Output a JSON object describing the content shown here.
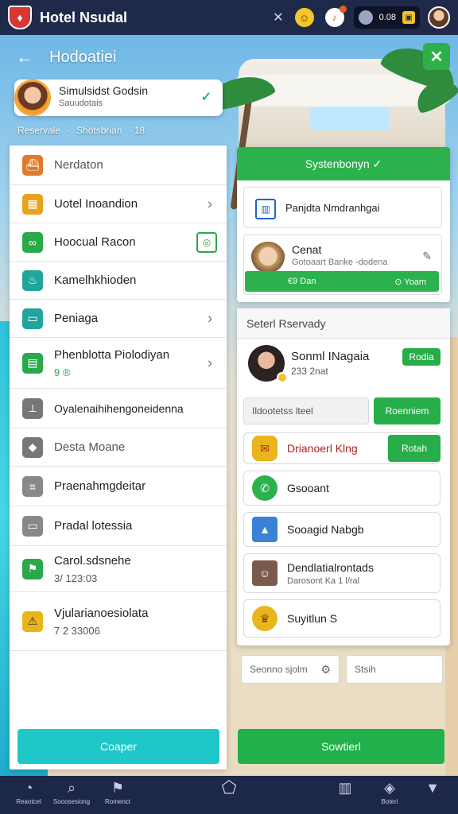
{
  "topbar": {
    "app_title": "Hotel Nsudal",
    "user_value": "0.08",
    "icons": [
      "shield-logo-icon",
      "close-icon",
      "emoji-icon",
      "bell-icon",
      "wallet-icon",
      "avatar"
    ]
  },
  "header": {
    "title": "Hodoatiei",
    "back_glyph": "←",
    "check_glyph": "✓"
  },
  "profile": {
    "name": "Simulsidst Godsin",
    "subtitle": "Sauudotais",
    "check_glyph": "✓"
  },
  "sublinks": [
    "Reservale",
    "·",
    "Shotsbrian",
    "· 18"
  ],
  "left_menu": [
    {
      "label": "Nerdaton",
      "icon": "ship-icon",
      "color": "#e07a2a",
      "chevron": false
    },
    {
      "label": "Uotel Inoandion",
      "icon": "hotel-icon",
      "color": "#e8a21d",
      "chevron": true
    },
    {
      "label": "Hoocual Racon",
      "icon": "link-icon",
      "color": "#2aa84a",
      "framed": true
    },
    {
      "label": "Kamelhkhioden",
      "icon": "kettle-icon",
      "color": "#1fa59a",
      "chevron": false
    },
    {
      "label": "Peniaga",
      "icon": "monitor-icon",
      "color": "#1fa59a",
      "chevron": true
    },
    {
      "label": "Phenblotta Piolodiyan",
      "sublabel": "9 ®",
      "icon": "briefcase-icon",
      "color": "#2aa84a",
      "chevron": true
    },
    {
      "label": "Oyalenaihihengoneidenna",
      "icon": "antenna-icon",
      "color": "#555555",
      "chevron": false
    },
    {
      "label": "Desta Moane",
      "icon": "diamond-icon",
      "color": "#555555",
      "chevron": false
    },
    {
      "label": "Praenahmgdeitar",
      "icon": "stack-icon",
      "color": "#777777",
      "chevron": false
    },
    {
      "label": "Pradal lotessia",
      "icon": "card-icon",
      "color": "#777777",
      "chevron": false
    },
    {
      "label": "Carol.sdsnehe",
      "sublabel": "3/ 123:03",
      "icon": "flag-icon",
      "color": "#2aa84a",
      "chevron": false
    },
    {
      "label": "Vjularianoesiolata",
      "sublabel": "7 2 33006",
      "icon": "warning-icon",
      "color": "#e8b51d",
      "chevron": false
    }
  ],
  "left_button": "Coaper",
  "right_top": {
    "header": "Systenbonyn ✓",
    "book_card": "Panjdta Nmdranhgai",
    "contact_name": "Cenat",
    "contact_sub": "Gotoaart Banke -dodena",
    "bar_left": "€9 Dan",
    "bar_right": "⊙ Yoam"
  },
  "right_main": {
    "header": "Seterl Rservady",
    "profile_name": "Sonml INagaia",
    "profile_sub": "233 2nat",
    "profile_btn": "Rodia",
    "input_value": "Ildootetss lteel",
    "input_btn": "Roenniem",
    "contacts": [
      {
        "label": "Drianoerl Klng",
        "icon": "mail-icon",
        "color": "#e8b51d",
        "btn": "Rotah",
        "red": true
      },
      {
        "label": "Gsooant",
        "icon": "phone-icon",
        "color": "#2bb24c"
      },
      {
        "label": "Sooagid Nabgb",
        "icon": "image-icon",
        "color": "#3a82d6"
      },
      {
        "label": "Dendlatialrontads",
        "sublabel": "Darosont Ka 1  l/ral",
        "icon": "person-icon",
        "color": "#7a5b4b"
      },
      {
        "label": "Suyitlun S",
        "icon": "trophy-icon",
        "color": "#e8b51d"
      }
    ]
  },
  "search_left": "Seonno sjolm",
  "search_right": "Stsih",
  "right_button": "Sowtierl",
  "bottom_nav": [
    {
      "label": "Reaotcel",
      "icon": "chat-icon"
    },
    {
      "label": "Sooosesiong",
      "icon": "search-icon"
    },
    {
      "label": "Romenct",
      "icon": "flag-icon"
    },
    {
      "label": "",
      "icon": "home-icon"
    },
    {
      "label": "",
      "icon": "book-icon"
    },
    {
      "label": "Boteri",
      "icon": "badge-icon"
    },
    {
      "label": "",
      "icon": "bookmark-icon"
    }
  ]
}
